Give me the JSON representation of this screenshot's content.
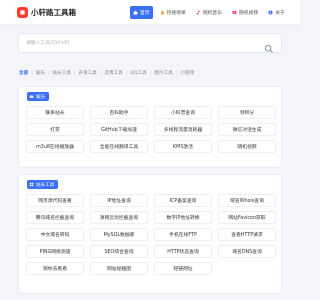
{
  "header": {
    "logo_text": "小轩路工具箱",
    "nav": [
      {
        "label": "首页",
        "icon": "home-icon",
        "active": true
      },
      {
        "label": "热搜榜单",
        "icon": "fire-icon",
        "active": false
      },
      {
        "label": "随机音乐",
        "icon": "music-icon",
        "active": false
      },
      {
        "label": "随机视频",
        "icon": "video-icon",
        "active": false
      },
      {
        "label": "关于",
        "icon": "info-icon",
        "active": false
      }
    ]
  },
  "search": {
    "placeholder": "请输入工具(Ctrl+K)",
    "icon": "search-icon"
  },
  "tags": [
    "全部",
    "娱乐",
    "站长工具",
    "开发工具",
    "实用工具",
    "QQ工具",
    "图片工具",
    "小游戏"
  ],
  "sections": [
    {
      "title": "娱乐",
      "icon": "gamepad-icon",
      "items": [
        "联系站长",
        "百科助手",
        "小科普查询",
        "领积分",
        "打赏",
        "GitHub下载加速",
        "多线程流量消耗器",
        "微信对话生成",
        "m3u8在线播放器",
        "全能在线翻译工具",
        "KMS激活",
        "随机视频"
      ]
    },
    {
      "title": "站长工具",
      "icon": "tools-icon",
      "items": [
        "网页源代码查看",
        "IP地址查询",
        "ICP备案查询",
        "域名Whois查询",
        "腾讯域名拦截查询",
        "净网云剑拦截查询",
        "数字IP地址转换",
        "网站Favicon获取",
        "中文域名转码",
        "MySQL数据库",
        "手机在线FTP",
        "查看HTTP请求",
        "PING网络测速",
        "SEO综合查询",
        "HTTP状态查询",
        "域名DNS查询",
        "锁你去看看",
        "网站秘籍图",
        "短链网址"
      ]
    }
  ],
  "colors": {
    "accent": "#3a6ff7",
    "logo": "#ff3b30",
    "background": "#f3f5fa"
  }
}
